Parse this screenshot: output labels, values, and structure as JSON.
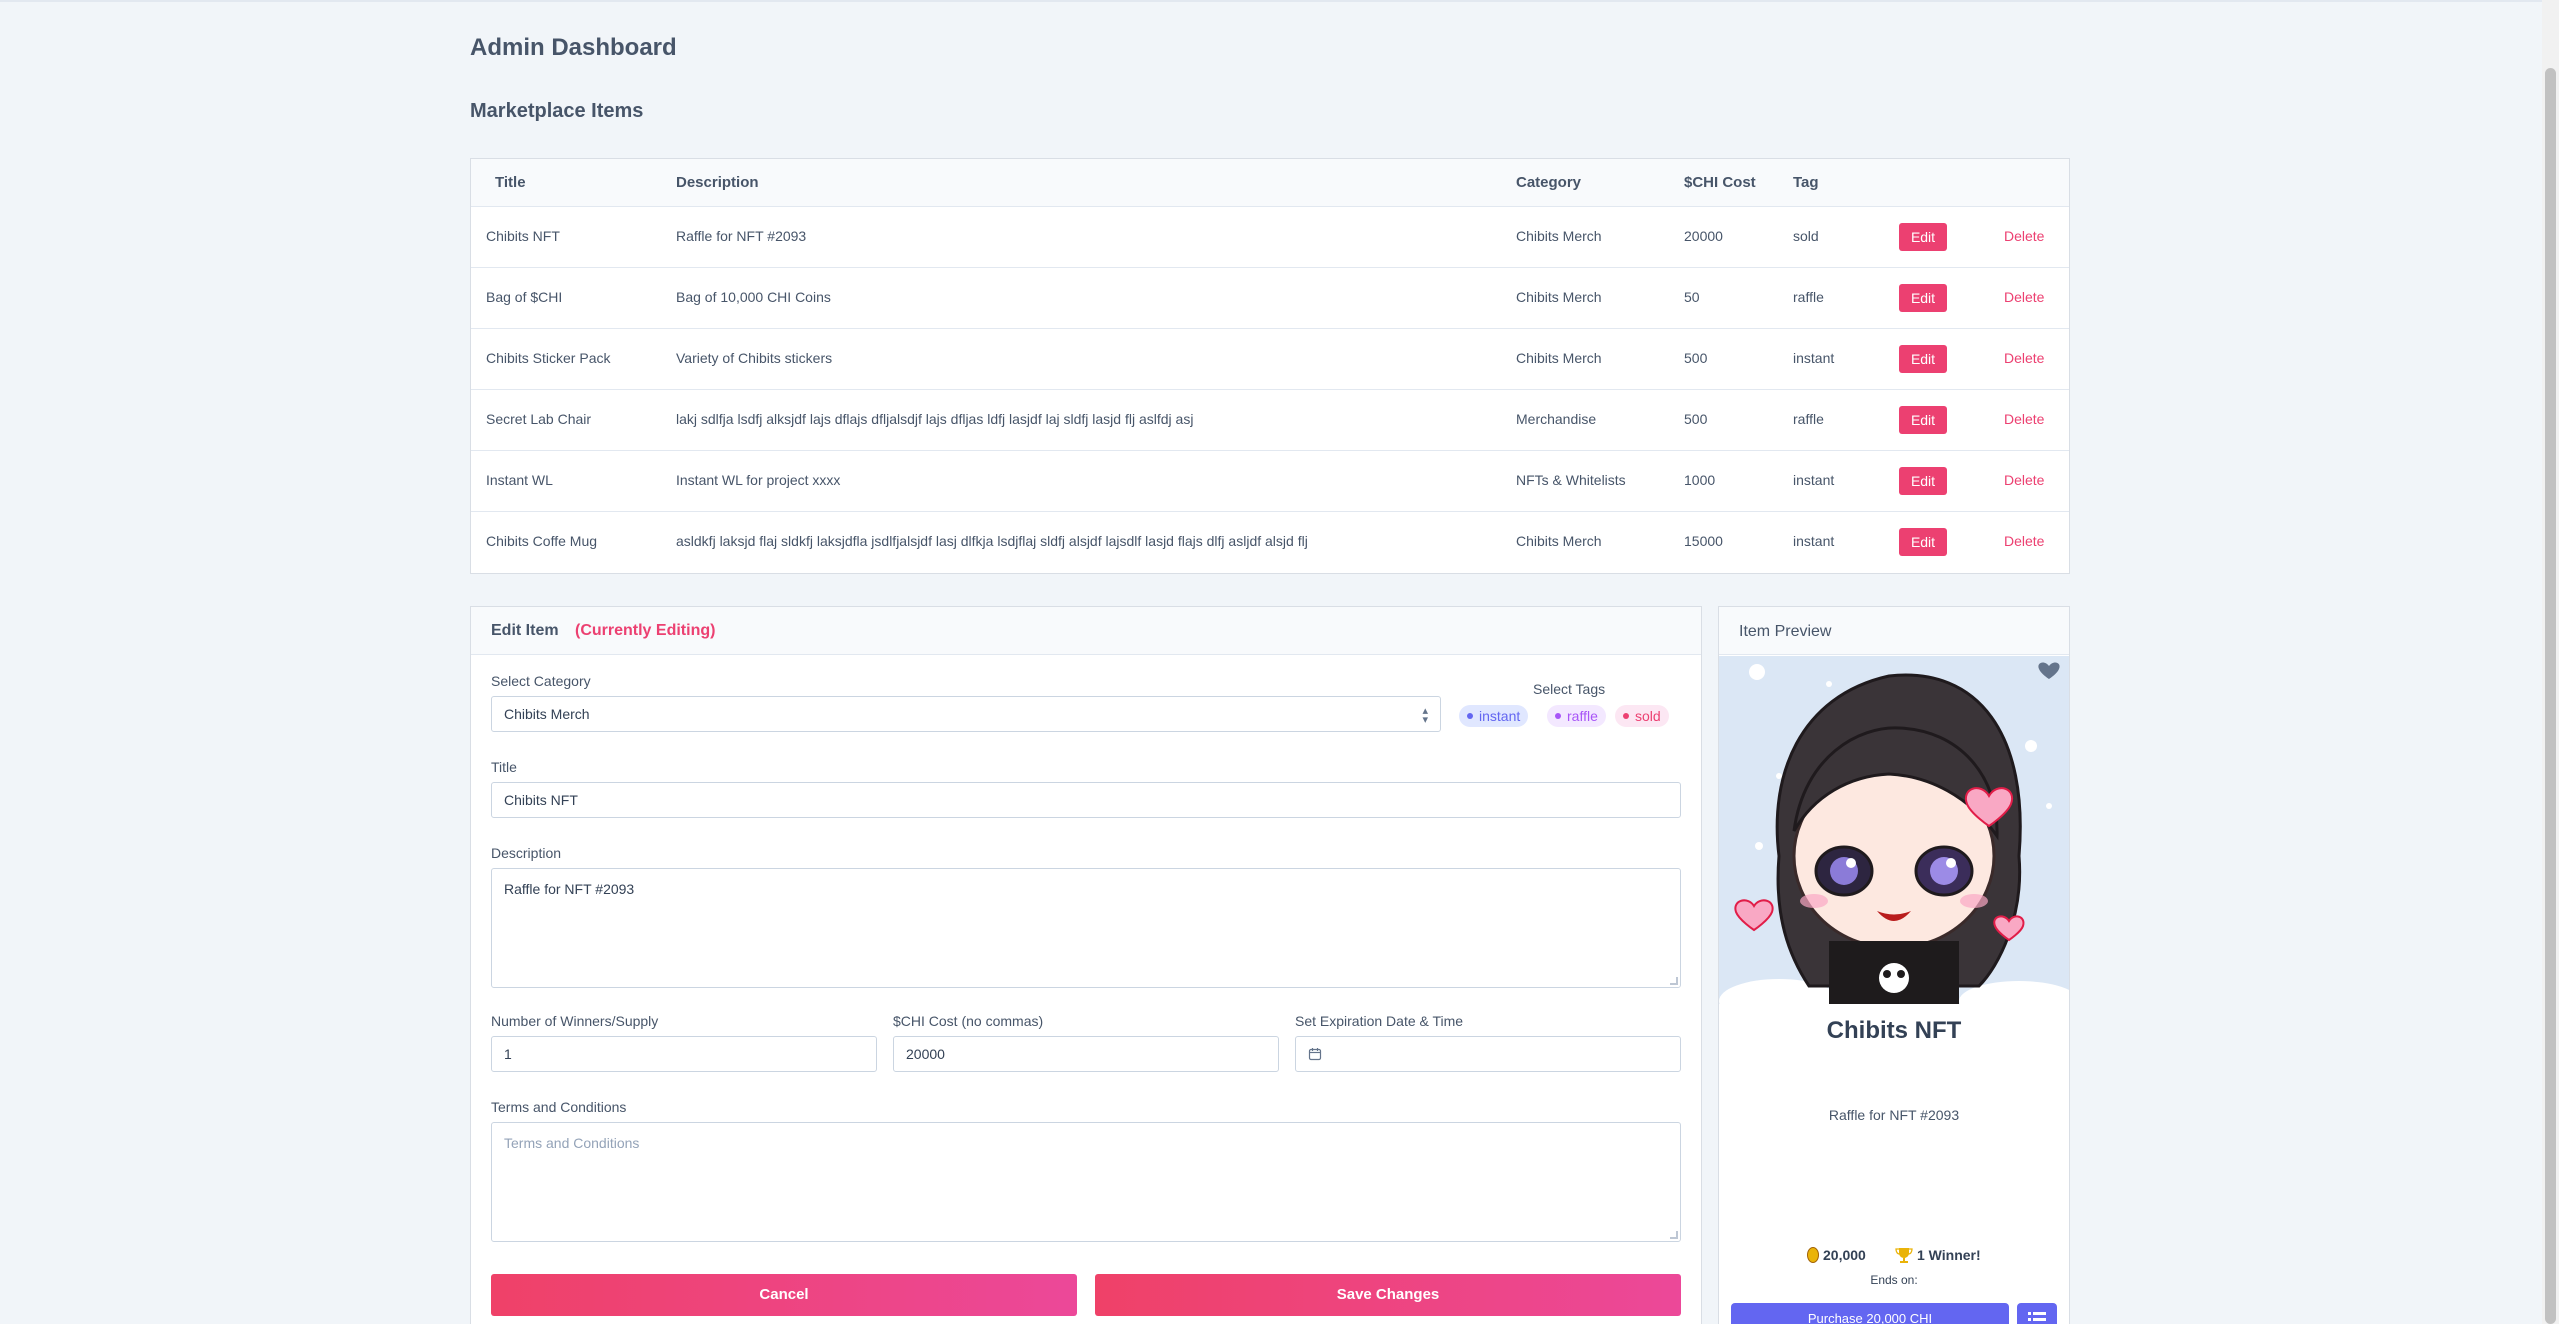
{
  "page": {
    "title": "Admin Dashboard",
    "section_title": "Marketplace Items"
  },
  "table": {
    "headers": {
      "title": "Title",
      "description": "Description",
      "category": "Category",
      "cost": "$CHI Cost",
      "tag": "Tag"
    },
    "edit_label": "Edit",
    "delete_label": "Delete",
    "rows": [
      {
        "title": "Chibits NFT",
        "description": "Raffle for NFT #2093",
        "category": "Chibits Merch",
        "cost": "20000",
        "tag": "sold"
      },
      {
        "title": "Bag of $CHI",
        "description": "Bag of 10,000 CHI Coins",
        "category": "Chibits Merch",
        "cost": "50",
        "tag": "raffle"
      },
      {
        "title": "Chibits Sticker Pack",
        "description": "Variety of Chibits stickers",
        "category": "Chibits Merch",
        "cost": "500",
        "tag": "instant"
      },
      {
        "title": "Secret Lab Chair",
        "description": "lakj sdlfja lsdfj alksjdf lajs dflajs dfljalsdjf lajs dfljas ldfj lasjdf laj sldfj lasjd flj aslfdj asj",
        "category": "Merchandise",
        "cost": "500",
        "tag": "raffle"
      },
      {
        "title": "Instant WL",
        "description": "Instant WL for project xxxx",
        "category": "NFTs & Whitelists",
        "cost": "1000",
        "tag": "instant"
      },
      {
        "title": "Chibits Coffe Mug",
        "description": "asldkfj laksjd flaj sldkfj laksjdfla jsdlfjalsjdf lasj dlfkja lsdjflaj sldfj alsjdf lajsdlf lasjd flajs dlfj asljdf alsjd flj",
        "category": "Chibits Merch",
        "cost": "15000",
        "tag": "instant"
      }
    ]
  },
  "edit": {
    "header": "Edit Item",
    "status": "(Currently Editing)",
    "category_label": "Select Category",
    "category_value": "Chibits Merch",
    "tags_label": "Select Tags",
    "tags": [
      {
        "label": "instant",
        "color": "#6366f1",
        "bg": "#e0e7ff"
      },
      {
        "label": "raffle",
        "color": "#a855f7",
        "bg": "#f3e8ff"
      },
      {
        "label": "sold",
        "color": "#ec4071",
        "bg": "#fce7f3"
      }
    ],
    "title_label": "Title",
    "title_value": "Chibits NFT",
    "description_label": "Description",
    "description_value": "Raffle for NFT #2093",
    "winners_label": "Number of Winners/Supply",
    "winners_value": "1",
    "cost_label": "$CHI Cost (no commas)",
    "cost_value": "20000",
    "expiration_label": "Set Expiration Date & Time",
    "terms_label": "Terms and Conditions",
    "terms_placeholder": "Terms and Conditions",
    "cancel_label": "Cancel",
    "save_label": "Save Changes"
  },
  "preview": {
    "header": "Item Preview",
    "title": "Chibits NFT",
    "description": "Raffle for NFT #2093",
    "cost": "20,000",
    "winners": "1 Winner!",
    "ends_on": "Ends on:",
    "purchase_label": "Purchase 20,000 CHI"
  },
  "colors": {
    "accent": "#ec4071",
    "purchase": "#6366f1"
  }
}
